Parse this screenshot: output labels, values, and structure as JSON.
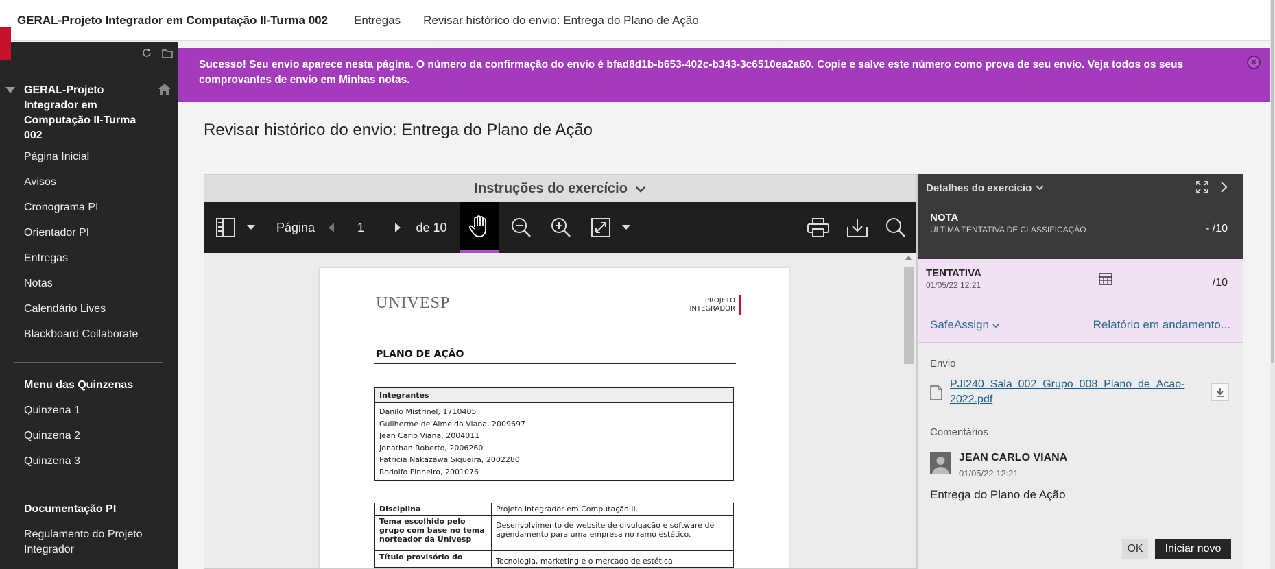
{
  "topbar": {
    "course": "GERAL-Projeto Integrador em Computação II-Turma 002",
    "crumb_entregas": "Entregas",
    "crumb_current": "Revisar histórico do envio: Entrega do Plano de Ação"
  },
  "sidebar": {
    "course_title": "GERAL-Projeto Integrador em Computação II-Turma 002",
    "items": [
      {
        "label": "Página Inicial"
      },
      {
        "label": "Avisos"
      },
      {
        "label": "Cronograma PI"
      },
      {
        "label": "Orientador PI"
      },
      {
        "label": "Entregas"
      },
      {
        "label": "Notas"
      },
      {
        "label": "Calendário Lives"
      },
      {
        "label": "Blackboard Collaborate"
      }
    ],
    "menu_heading": "Menu das Quinzenas",
    "menu_items": [
      {
        "label": "Quinzena 1"
      },
      {
        "label": "Quinzena 2"
      },
      {
        "label": "Quinzena 3"
      }
    ],
    "doc_heading": "Documentação PI",
    "doc_items": [
      {
        "label": "Regulamento do Projeto Integrador"
      }
    ]
  },
  "banner": {
    "message": "Sucesso! Seu envio aparece nesta página. O número da confirmação do envio é bfad8d1b-b653-402c-b343-3c6510ea2a60. Copie e salve este número como prova de seu envio. ",
    "link": "Veja todos os seus comprovantes de envio em Minhas notas."
  },
  "page_title": "Revisar histórico do envio: Entrega do Plano de Ação",
  "viewer": {
    "instructions_label": "Instruções do exercício",
    "page_label": "Página",
    "page_number": "1",
    "page_of": "de 10"
  },
  "document": {
    "logo": "UNIVESP",
    "proj_line1": "PROJETO",
    "proj_line2": "INTEGRADOR",
    "heading": "PLANO DE AÇÃO",
    "members_header": "Integrantes",
    "members": [
      "Danilo Mistrinel, 1710405",
      "Guilherme de Almeida Viana, 2009697",
      "Jean Carlo Viana, 2004011",
      "Jonathan Roberto, 2006260",
      "Patricia Nakazawa Siqueira, 2002280",
      "Rodolfo Pinheiro, 2001076"
    ],
    "rows": [
      {
        "key": "Disciplina",
        "value": "Projeto Integrador em Computação II."
      },
      {
        "key": "Tema escolhido pelo grupo com base no tema norteador da Univesp",
        "value": "Desenvolvimento de website de divulgação e software de agendamento para uma empresa no ramo estético."
      },
      {
        "key": "Título provisório do",
        "value": "Tecnologia, marketing e o mercado de estética."
      }
    ]
  },
  "details": {
    "header": "Detalhes do exercício",
    "nota_title": "NOTA",
    "nota_sub": "ÚLTIMA TENTATIVA DE CLASSIFICAÇÃO",
    "nota_score": "- /10",
    "tentativa_title": "TENTATIVA",
    "tentativa_date": "01/05/22 12:21",
    "tentativa_score": "/10",
    "safeassign": "SafeAssign",
    "report": "Relatório em andamento...",
    "envio_label": "Envio",
    "file_name": "PJI240_Sala_002_Grupo_008_Plano_de_Acao-2022.pdf",
    "comments_label": "Comentários",
    "comment_author": "JEAN CARLO VIANA",
    "comment_date": "01/05/22 12:21",
    "comment_text": "Entrega do Plano de Ação",
    "ok_button": "OK",
    "new_button": "Iniciar novo"
  },
  "colors": {
    "banner": "#a43bbd",
    "sidebar": "#262626",
    "accent_red": "#c8102e",
    "link": "#1a5e8f"
  }
}
